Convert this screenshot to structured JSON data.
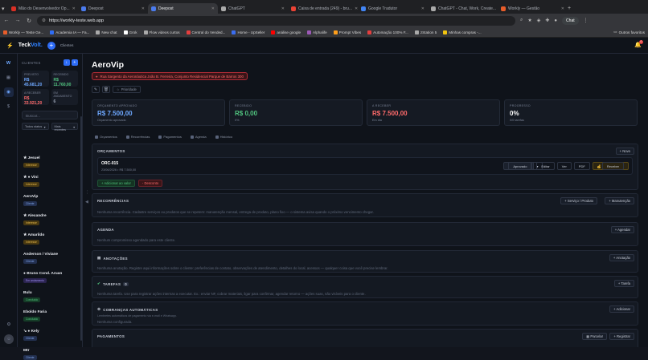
{
  "browser": {
    "tabs": [
      {
        "title": "Mão do Desenvolvedor Op...",
        "color": "#d93025"
      },
      {
        "title": "Deepost",
        "color": "#4b7bec"
      },
      {
        "title": "Deepost",
        "color": "#4b7bec",
        "active": true
      },
      {
        "title": "ChatGPT",
        "color": "#aaaaaa"
      },
      {
        "title": "Caixa de entrada (249) - bru...",
        "color": "#ea4335"
      },
      {
        "title": "Google Tradutor",
        "color": "#4285f4"
      },
      {
        "title": "ChatGPT - Chat, Work, Create...",
        "color": "#aaaaaa"
      },
      {
        "title": "Workly — Gestão",
        "color": "#e85d2a"
      }
    ],
    "url": "https://workly-teste.web.app",
    "chat_label": "Chat",
    "bookmarks": [
      "Workly — Teste Ge...",
      "Academia IA — Fa...",
      "New chat",
      "Grok",
      "Flow videos curtos",
      "Central do Vended...",
      "Home - UpSeller",
      "análise google",
      "Alphalife",
      "Prompt Vibes",
      "Automação 100% F...",
      "zStation 5",
      "Minhas compras -..."
    ],
    "other_bookmarks": "Outros favoritos"
  },
  "app": {
    "logo_a": "Teck",
    "logo_b": "Volt.",
    "clients_label": "Clientes",
    "notif_count": "0",
    "sidebar": {
      "title": "CLIENTES",
      "stats": [
        {
          "label": "PREVISTO",
          "value": "R$ 45.681,20",
          "color": "#6ea8ff"
        },
        {
          "label": "RECEBIDO",
          "value": "R$ 11.760,00",
          "color": "#51c47f"
        },
        {
          "label": "A RECEBER",
          "value": "R$ 33.921,20",
          "color": "#ff6b6b"
        },
        {
          "label": "EM ANDAMENTO",
          "value": "6",
          "color": "#9aa2b2"
        }
      ],
      "search_placeholder": "Buscar...",
      "filter_status": "Todos status",
      "filter_sort": "Mais recentes",
      "clients": [
        {
          "name": "★ Jesuel",
          "tag": "Interesse",
          "cls": "t-int"
        },
        {
          "name": "★ ● Vini",
          "tag": "Interesse",
          "cls": "t-int"
        },
        {
          "name": "AeroVip",
          "tag": "Cliente",
          "cls": "t-cli"
        },
        {
          "name": "★ Alexandre",
          "tag": "Interesse",
          "cls": "t-int"
        },
        {
          "name": "★ Amarildo",
          "tag": "Interesse",
          "cls": "t-int"
        },
        {
          "name": "Anderson / Viviane",
          "tag": "Cliente",
          "cls": "t-cli"
        },
        {
          "name": "● Bruno Cond. Aruan",
          "tag": "Em andamento",
          "cls": "t-and"
        },
        {
          "name": "Bulu",
          "tag": "Concluído",
          "cls": "t-con"
        },
        {
          "name": "Eboldo Faria",
          "tag": "Concluído",
          "cls": "t-con"
        },
        {
          "name": "↘ ● Kely",
          "tag": "Cliente",
          "cls": "t-cli"
        },
        {
          "name": "Mtr",
          "tag": "Cliente",
          "cls": "t-cli"
        }
      ]
    },
    "client": {
      "name": "AeroVip",
      "address": "Rua Sargento da Aeronáutica João B. Ferreira, Conjunto Residencial Parque de Barros 300",
      "priority_label": "Prioridade",
      "cards": [
        {
          "label": "ORÇAMENTO APROVADO",
          "value": "R$ 7.500,00",
          "sub": "Orçamento aprovado",
          "color": "#6ea8ff"
        },
        {
          "label": "RECEBIDO",
          "value": "R$ 0,00",
          "sub": "0%",
          "color": "#51c47f"
        },
        {
          "label": "A RECEBER",
          "value": "R$ 7.500,00",
          "sub": "Em dia",
          "color": "#ff6b6b"
        },
        {
          "label": "PROGRESSO",
          "value": "0%",
          "sub": "0/0 tarefas",
          "color": "#ffffff"
        }
      ],
      "tabs": [
        "Orçamentos",
        "Recorrências",
        "Pagamentos",
        "Agenda",
        "Histórico"
      ],
      "budgets": {
        "title": "ORÇAMENTOS",
        "new_btn": "+ Novo",
        "item_id": "ORC-015",
        "item_detail": "23/06/2026 • R$ 7.500,00",
        "status": "Aprovado",
        "edit": "Editar",
        "view": "Ver",
        "pdf": "PDF",
        "receive": "Receber",
        "add_value": "+ Adicionar ao valor",
        "discount": "- Desconto"
      },
      "recurrence": {
        "title": "RECORRÊNCIAS",
        "btn1": "+ Serviço / Produto",
        "btn2": "+ Manutenção",
        "empty": "Nenhuma recorrência. Cadastre serviços ou produtos que se repetem: manutenção mensal, entrega de produto, plano fixo — o sistema avisa quando o próximo vencimento chegar."
      },
      "agenda": {
        "title": "AGENDA",
        "btn": "+ Agendar",
        "empty": "Nenhum compromisso agendado para este cliente."
      },
      "notes": {
        "title": "ANOTAÇÕES",
        "btn": "+ Anotação",
        "empty": "Nenhuma anotação. Registre aqui informações sobre o cliente: preferências de contato, observações de atendimento, detalhes do local, acessos — qualquer coisa que você precise lembrar."
      },
      "tasks": {
        "title": "TAREFAS",
        "badge": "0",
        "btn": "+ Tarefa",
        "empty": "Nenhuma tarefa. Use para registrar ações internas a executar. Ex.: enviar NF, cobrar materiais, ligar para confirmar, agendar retorno — ações suas, não visíveis para o cliente."
      },
      "charges": {
        "title": "COBRANÇAS AUTOMÁTICAS",
        "btn": "+ Adicionar",
        "sub": "Lembretes automáticos de pagamento via e-mail e Whatsapp.",
        "empty": "Nenhuma configurada."
      },
      "payments": {
        "title": "PAGAMENTOS",
        "btn1": "Parcelar",
        "btn2": "+ Registrar"
      }
    }
  }
}
